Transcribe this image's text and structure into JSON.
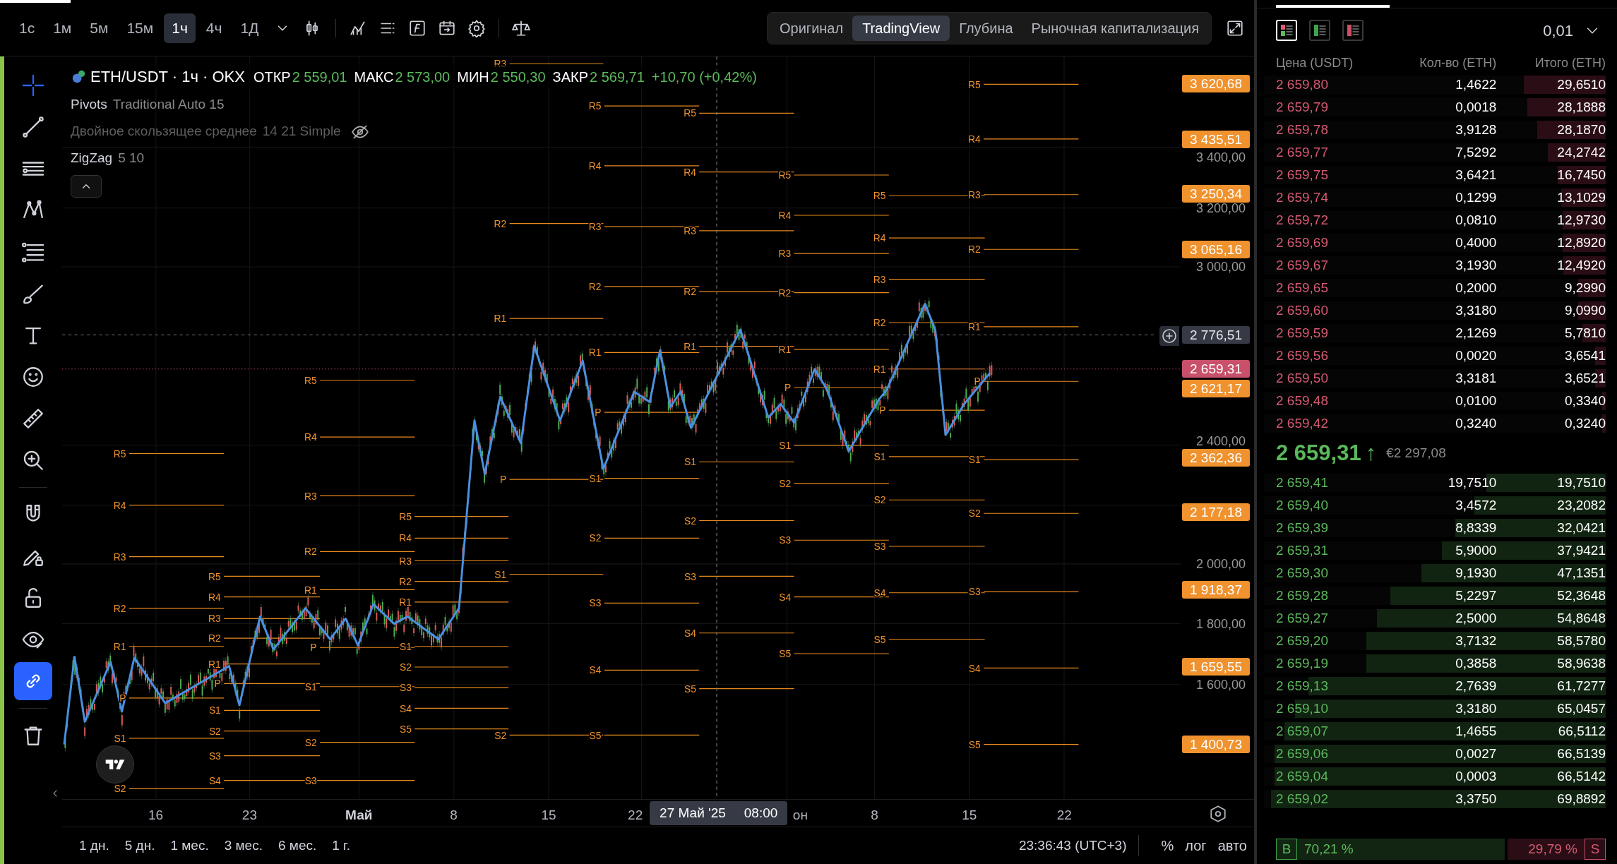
{
  "toolbar": {
    "intervals": [
      {
        "label": "1с",
        "selected": false
      },
      {
        "label": "1м",
        "selected": false
      },
      {
        "label": "5м",
        "selected": false
      },
      {
        "label": "15м",
        "selected": false
      },
      {
        "label": "1ч",
        "selected": true
      },
      {
        "label": "4ч",
        "selected": false
      },
      {
        "label": "1Д",
        "selected": false
      }
    ],
    "views": [
      {
        "label": "Оригинал",
        "selected": false
      },
      {
        "label": "TradingView",
        "selected": true
      },
      {
        "label": "Глубина",
        "selected": false
      },
      {
        "label": "Рыночная капитализация",
        "selected": false
      }
    ]
  },
  "left_tools": [
    {
      "kind": "crosshair",
      "selected": false
    },
    {
      "kind": "trend-line",
      "selected": false
    },
    {
      "kind": "horizontal-lines",
      "selected": false
    },
    {
      "kind": "pattern",
      "selected": false
    },
    {
      "kind": "fib",
      "selected": false
    },
    {
      "kind": "brush",
      "selected": false
    },
    {
      "kind": "text",
      "selected": false
    },
    {
      "kind": "emoji",
      "selected": false
    },
    {
      "kind": "ruler",
      "selected": false
    },
    {
      "kind": "zoom",
      "selected": false
    },
    {
      "kind": "magnet",
      "selected": false
    },
    {
      "kind": "lock-pencil",
      "selected": false
    },
    {
      "kind": "lock",
      "selected": false
    },
    {
      "kind": "eye",
      "selected": false
    },
    {
      "kind": "link",
      "selected": true
    },
    {
      "kind": "trash",
      "selected": false
    }
  ],
  "legend": {
    "symbol": "ETH/USDT · 1ч · OKX",
    "ohlc": [
      {
        "label": "ОТКР",
        "value": "2 559,01"
      },
      {
        "label": "МАКС",
        "value": "2 573,00"
      },
      {
        "label": "МИН",
        "value": "2 550,30"
      },
      {
        "label": "ЗАКР",
        "value": "2 569,71"
      }
    ],
    "change": "+10,70 (+0,42%)",
    "indicators": [
      {
        "name": "Pivots",
        "params": "Traditional Auto 15",
        "hidden": false
      },
      {
        "name": "Двойное скользящее среднее",
        "params": "14 21 Simple",
        "hidden": true
      },
      {
        "name": "ZigZag",
        "params": "5 10",
        "hidden": false
      }
    ]
  },
  "pivot_periods": [
    {
      "levels": [
        "R5",
        "R4",
        "R3",
        "R2",
        "R1",
        "P",
        "S1",
        "S2"
      ]
    },
    {
      "levels": [
        "R5",
        "R4",
        "R3",
        "R2",
        "R1",
        "P",
        "S1",
        "S2",
        "S3",
        "S4"
      ]
    },
    {
      "levels": [
        "R5",
        "R4",
        "R3",
        "R2",
        "R1",
        "P",
        "S1",
        "S2",
        "S3"
      ]
    },
    {
      "levels": [
        "R5",
        "R4",
        "R3",
        "R2",
        "R1",
        "S1",
        "S2",
        "S3",
        "S4",
        "S5"
      ]
    },
    {
      "levels": [
        "R3",
        "R2",
        "R1",
        "P",
        "S1",
        "S2"
      ]
    },
    {
      "levels": [
        "R5",
        "R4",
        "R3",
        "R2",
        "R1",
        "P",
        "S1",
        "S2",
        "S3",
        "S4",
        "S5"
      ]
    },
    {
      "levels": [
        "R5",
        "R4",
        "R3",
        "R2",
        "R1",
        "S1",
        "S2",
        "S3",
        "S4",
        "S5"
      ]
    },
    {
      "levels": [
        "R5",
        "R4",
        "R3",
        "R2",
        "R1",
        "P",
        "S1",
        "S2",
        "S3",
        "S4",
        "S5"
      ]
    },
    {
      "levels": [
        "R5",
        "R4",
        "R3",
        "R2",
        "R1",
        "P",
        "S1",
        "S2",
        "S3",
        "S4",
        "S5"
      ]
    },
    {
      "levels": [
        "R5",
        "R4",
        "R3",
        "R2",
        "R1",
        "P",
        "S1",
        "S2",
        "S3",
        "S4",
        "S5"
      ]
    }
  ],
  "price_axis": {
    "ticks": [
      "3 400,00",
      "3 200,00",
      "3 000,00",
      "2 400,00",
      "2 000,00",
      "1 800,00",
      "1 600,00"
    ],
    "tags": [
      {
        "text": "3 620,68",
        "kind": "pivot"
      },
      {
        "text": "3 435,51",
        "kind": "pivot"
      },
      {
        "text": "3 250,34",
        "kind": "pivot"
      },
      {
        "text": "3 065,16",
        "kind": "pivot"
      },
      {
        "text": "2 776,51",
        "kind": "crosshair"
      },
      {
        "text": "2 659,31",
        "kind": "last"
      },
      {
        "text": "2 621,17",
        "kind": "pivot"
      },
      {
        "text": "2 362,36",
        "kind": "pivot"
      },
      {
        "text": "2 177,18",
        "kind": "pivot"
      },
      {
        "text": "1 918,37",
        "kind": "pivot"
      },
      {
        "text": "1 659,55",
        "kind": "pivot"
      },
      {
        "text": "1 400,73",
        "kind": "pivot"
      }
    ]
  },
  "time_axis": [
    {
      "label": "16",
      "bold": false
    },
    {
      "label": "23",
      "bold": false
    },
    {
      "label": "Май",
      "bold": true
    },
    {
      "label": "8",
      "bold": false
    },
    {
      "label": "15",
      "bold": false
    },
    {
      "label": "22",
      "bold": false
    },
    {
      "label": "он",
      "bold": false
    },
    {
      "label": "8",
      "bold": false
    },
    {
      "label": "15",
      "bold": false
    },
    {
      "label": "22",
      "bold": false
    }
  ],
  "crosshair_time": {
    "date": "27 Май '25",
    "time": "08:00"
  },
  "ranges": [
    "1 дн.",
    "5 дн.",
    "1 мес.",
    "3 мес.",
    "6 мес.",
    "1 г."
  ],
  "clock": "23:36:43 (UTC+3)",
  "scale_options": [
    "%",
    "лог",
    "авто"
  ],
  "order_book": {
    "layouts": [
      {
        "kind": "both",
        "selected": true
      },
      {
        "kind": "bids",
        "selected": false
      },
      {
        "kind": "asks",
        "selected": false
      }
    ],
    "tick_size": "0,01",
    "columns": [
      "Цена (USDT)",
      "Кол-во (ETH)",
      "Итого (ETH)"
    ],
    "asks": [
      {
        "price": "2 659,80",
        "amount": "1,4622",
        "total": "29,6510",
        "level": 0.24
      },
      {
        "price": "2 659,79",
        "amount": "0,0018",
        "total": "28,1888",
        "level": 0.23
      },
      {
        "price": "2 659,78",
        "amount": "3,9128",
        "total": "28,1870",
        "level": 0.2
      },
      {
        "price": "2 659,77",
        "amount": "7,5292",
        "total": "24,2742",
        "level": 0.17
      },
      {
        "price": "2 659,75",
        "amount": "3,6421",
        "total": "16,7450",
        "level": 0.14
      },
      {
        "price": "2 659,74",
        "amount": "0,1299",
        "total": "13,1029",
        "level": 0.13
      },
      {
        "price": "2 659,72",
        "amount": "0,0810",
        "total": "12,9730",
        "level": 0.126
      },
      {
        "price": "2 659,69",
        "amount": "0,4000",
        "total": "12,8920",
        "level": 0.126
      },
      {
        "price": "2 659,67",
        "amount": "3,1930",
        "total": "12,4920",
        "level": 0.124
      },
      {
        "price": "2 659,65",
        "amount": "0,2000",
        "total": "9,2990",
        "level": 0.08
      },
      {
        "price": "2 659,60",
        "amount": "3,3180",
        "total": "9,0990",
        "level": 0.08
      },
      {
        "price": "2 659,59",
        "amount": "2,1269",
        "total": "5,7810",
        "level": 0.068
      },
      {
        "price": "2 659,56",
        "amount": "0,0020",
        "total": "3,6541",
        "level": 0.03
      },
      {
        "price": "2 659,50",
        "amount": "3,3181",
        "total": "3,6521",
        "level": 0.03
      },
      {
        "price": "2 659,48",
        "amount": "0,0100",
        "total": "0,3340",
        "level": 0.01
      },
      {
        "price": "2 659,42",
        "amount": "0,3240",
        "total": "0,3240",
        "level": 0.01
      }
    ],
    "last_price": "2 659,31",
    "trend_arrow": "↑",
    "fiat_price": "€2 297,08",
    "bids": [
      {
        "price": "2 659,41",
        "amount": "19,7510",
        "total": "19,7510",
        "level": 0.35
      },
      {
        "price": "2 659,40",
        "amount": "3,4572",
        "total": "23,2082",
        "level": 0.385
      },
      {
        "price": "2 659,39",
        "amount": "8,8339",
        "total": "32,0421",
        "level": 0.44
      },
      {
        "price": "2 659,31",
        "amount": "5,9000",
        "total": "37,9421",
        "level": 0.48
      },
      {
        "price": "2 659,30",
        "amount": "9,1930",
        "total": "47,1351",
        "level": 0.54
      },
      {
        "price": "2 659,28",
        "amount": "5,2297",
        "total": "52,3648",
        "level": 0.63
      },
      {
        "price": "2 659,27",
        "amount": "2,5000",
        "total": "54,8648",
        "level": 0.67
      },
      {
        "price": "2 659,20",
        "amount": "3,7132",
        "total": "58,5780",
        "level": 0.7
      },
      {
        "price": "2 659,19",
        "amount": "0,3858",
        "total": "58,9638",
        "level": 0.7
      },
      {
        "price": "2 659,13",
        "amount": "2,7639",
        "total": "61,7277",
        "level": 0.87
      },
      {
        "price": "2 659,10",
        "amount": "3,3180",
        "total": "65,0457",
        "level": 0.91
      },
      {
        "price": "2 659,07",
        "amount": "1,4655",
        "total": "66,5112",
        "level": 0.94
      },
      {
        "price": "2 659,06",
        "amount": "0,0027",
        "total": "66,5139",
        "level": 0.97
      },
      {
        "price": "2 659,04",
        "amount": "0,0003",
        "total": "66,5142",
        "level": 0.97
      },
      {
        "price": "2 659,02",
        "amount": "3,3750",
        "total": "69,8892",
        "level": 0.98
      }
    ],
    "ratio": {
      "buy_label": "B",
      "buy": "70,21 %",
      "sell": "29,79 %",
      "sell_label": "S",
      "level": 0.7021
    }
  }
}
